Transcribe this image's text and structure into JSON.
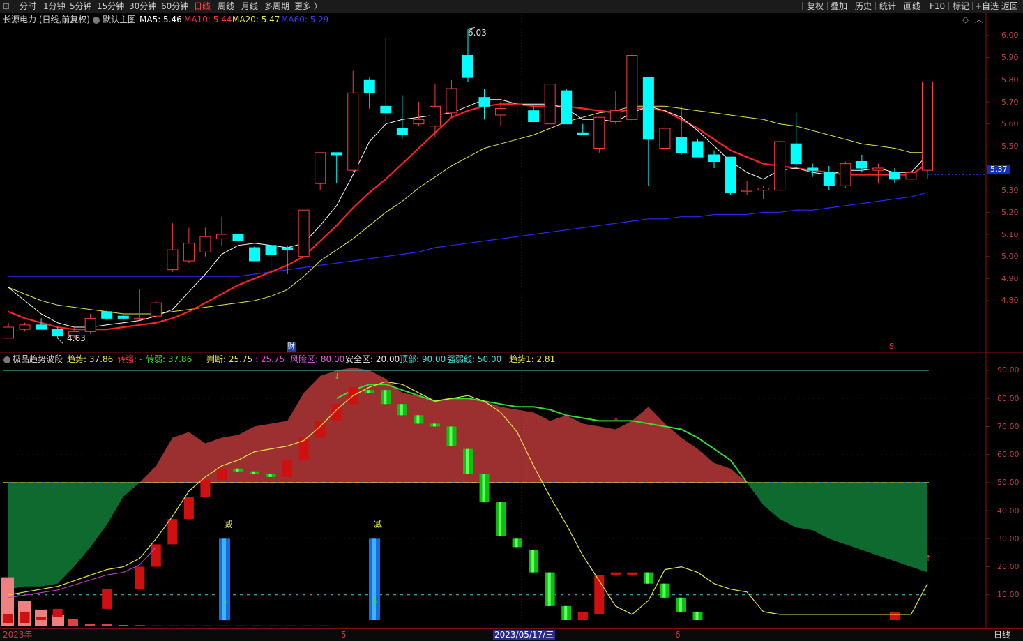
{
  "toolbar": {
    "left_tabs": [
      "分时",
      "1分钟",
      "5分钟",
      "15分钟",
      "30分钟",
      "60分钟",
      "日线",
      "周线",
      "月线",
      "多周期",
      "更多 〉"
    ],
    "active_tab": "日线",
    "right_items": [
      "复权",
      "叠加",
      "历史",
      "统计",
      "画线",
      "F10",
      "标记",
      "+自选",
      "返回"
    ]
  },
  "main_chart": {
    "title": "长源电力 (日线,前复权)",
    "template": "默认主图",
    "ma5": "MA5: 5.46",
    "ma10": "MA10: 5.44",
    "ma20": "MA20: 5.47",
    "ma60": "MA60: 5.29",
    "high_label": "6.03",
    "low_label": "4.63",
    "price_tag": "5.37",
    "finance_mark": "财",
    "s_mark": "S",
    "y_ticks": [
      "6.00",
      "5.90",
      "5.80",
      "5.70",
      "5.60",
      "5.50",
      "5.40",
      "5.30",
      "5.20",
      "5.10",
      "5.00",
      "4.90",
      "4.80"
    ]
  },
  "indicator": {
    "name": "极品趋势波段",
    "trend": "趋势: 37.86",
    "strong": "转强: -",
    "weak": "转弱: 37.86",
    "judge": "判断: 25.75",
    "judge2": ": 25.75",
    "risk": "风险区: 80.00",
    "safe": "安全区: 20.00",
    "top": "顶部: 90.00",
    "strength_line": "强弱线: 50.00",
    "trend1": "趋势1: 2.81",
    "reduce_label_1": "减",
    "reduce_label_2": "减",
    "y_ticks": [
      "90.00",
      "80.00",
      "70.00",
      "60.00",
      "50.00",
      "40.00",
      "30.00",
      "20.00",
      "10.00"
    ]
  },
  "x_axis": {
    "labels": [
      "2023年",
      "5",
      "2023/05/17/三",
      "6"
    ],
    "period": "日线"
  },
  "colors": {
    "up": "#ff3b3b",
    "down": "#00ffff",
    "ma5": "#ffffff",
    "ma10": "#ff2020",
    "ma20": "#e8e840",
    "ma60": "#2a2aff",
    "risk_fill": "#9c2f2f",
    "safe_fill": "#0e6a2e"
  },
  "chart_data": {
    "type": "candlestick",
    "ylim": [
      4.6,
      6.07
    ],
    "candles": [
      {
        "o": 4.63,
        "h": 4.7,
        "l": 4.63,
        "c": 4.68
      },
      {
        "o": 4.67,
        "h": 4.7,
        "l": 4.66,
        "c": 4.69
      },
      {
        "o": 4.69,
        "h": 4.72,
        "l": 4.67,
        "c": 4.67
      },
      {
        "o": 4.67,
        "h": 4.68,
        "l": 4.63,
        "c": 4.64
      },
      {
        "o": 4.64,
        "h": 4.68,
        "l": 4.63,
        "c": 4.66
      },
      {
        "o": 4.66,
        "h": 4.74,
        "l": 4.65,
        "c": 4.72
      },
      {
        "o": 4.75,
        "h": 4.76,
        "l": 4.71,
        "c": 4.72
      },
      {
        "o": 4.73,
        "h": 4.74,
        "l": 4.71,
        "c": 4.72
      },
      {
        "o": 4.72,
        "h": 4.85,
        "l": 4.71,
        "c": 4.72
      },
      {
        "o": 4.73,
        "h": 4.8,
        "l": 4.72,
        "c": 4.79
      },
      {
        "o": 4.94,
        "h": 5.15,
        "l": 4.93,
        "c": 5.03
      },
      {
        "o": 4.98,
        "h": 5.13,
        "l": 4.97,
        "c": 5.06
      },
      {
        "o": 5.02,
        "h": 5.13,
        "l": 5.0,
        "c": 5.09
      },
      {
        "o": 5.08,
        "h": 5.18,
        "l": 5.05,
        "c": 5.1
      },
      {
        "o": 5.1,
        "h": 5.11,
        "l": 5.05,
        "c": 5.07
      },
      {
        "o": 5.04,
        "h": 5.05,
        "l": 4.98,
        "c": 4.98
      },
      {
        "o": 5.05,
        "h": 5.06,
        "l": 4.92,
        "c": 5.01
      },
      {
        "o": 5.04,
        "h": 5.05,
        "l": 4.92,
        "c": 5.03
      },
      {
        "o": 5.0,
        "h": 5.21,
        "l": 5.0,
        "c": 5.21
      },
      {
        "o": 5.33,
        "h": 5.47,
        "l": 5.3,
        "c": 5.47
      },
      {
        "o": 5.47,
        "h": 5.47,
        "l": 5.33,
        "c": 5.46
      },
      {
        "o": 5.39,
        "h": 5.84,
        "l": 5.38,
        "c": 5.74
      },
      {
        "o": 5.8,
        "h": 5.81,
        "l": 5.67,
        "c": 5.74
      },
      {
        "o": 5.68,
        "h": 5.99,
        "l": 5.61,
        "c": 5.65
      },
      {
        "o": 5.58,
        "h": 5.73,
        "l": 5.53,
        "c": 5.55
      },
      {
        "o": 5.6,
        "h": 5.7,
        "l": 5.59,
        "c": 5.62
      },
      {
        "o": 5.59,
        "h": 5.78,
        "l": 5.54,
        "c": 5.68
      },
      {
        "o": 5.65,
        "h": 5.8,
        "l": 5.63,
        "c": 5.76
      },
      {
        "o": 5.91,
        "h": 6.03,
        "l": 5.79,
        "c": 5.81
      },
      {
        "o": 5.72,
        "h": 5.76,
        "l": 5.62,
        "c": 5.68
      },
      {
        "o": 5.64,
        "h": 5.7,
        "l": 5.59,
        "c": 5.67
      },
      {
        "o": 5.69,
        "h": 5.73,
        "l": 5.64,
        "c": 5.69
      },
      {
        "o": 5.66,
        "h": 5.68,
        "l": 5.61,
        "c": 5.61
      },
      {
        "o": 5.6,
        "h": 5.78,
        "l": 5.6,
        "c": 5.78
      },
      {
        "o": 5.75,
        "h": 5.76,
        "l": 5.6,
        "c": 5.6
      },
      {
        "o": 5.56,
        "h": 5.6,
        "l": 5.55,
        "c": 5.55
      },
      {
        "o": 5.49,
        "h": 5.63,
        "l": 5.47,
        "c": 5.63
      },
      {
        "o": 5.61,
        "h": 5.75,
        "l": 5.6,
        "c": 5.66
      },
      {
        "o": 5.62,
        "h": 5.91,
        "l": 5.61,
        "c": 5.91
      },
      {
        "o": 5.81,
        "h": 5.81,
        "l": 5.32,
        "c": 5.53
      },
      {
        "o": 5.49,
        "h": 5.68,
        "l": 5.44,
        "c": 5.58
      },
      {
        "o": 5.54,
        "h": 5.68,
        "l": 5.46,
        "c": 5.47
      },
      {
        "o": 5.52,
        "h": 5.53,
        "l": 5.45,
        "c": 5.45
      },
      {
        "o": 5.46,
        "h": 5.48,
        "l": 5.4,
        "c": 5.43
      },
      {
        "o": 5.45,
        "h": 5.45,
        "l": 5.28,
        "c": 5.29
      },
      {
        "o": 5.3,
        "h": 5.34,
        "l": 5.28,
        "c": 5.3
      },
      {
        "o": 5.3,
        "h": 5.32,
        "l": 5.26,
        "c": 5.31
      },
      {
        "o": 5.3,
        "h": 5.52,
        "l": 5.3,
        "c": 5.52
      },
      {
        "o": 5.51,
        "h": 5.65,
        "l": 5.4,
        "c": 5.42
      },
      {
        "o": 5.4,
        "h": 5.42,
        "l": 5.36,
        "c": 5.39
      },
      {
        "o": 5.38,
        "h": 5.41,
        "l": 5.3,
        "c": 5.32
      },
      {
        "o": 5.32,
        "h": 5.43,
        "l": 5.31,
        "c": 5.42
      },
      {
        "o": 5.43,
        "h": 5.46,
        "l": 5.38,
        "c": 5.4
      },
      {
        "o": 5.39,
        "h": 5.42,
        "l": 5.33,
        "c": 5.4
      },
      {
        "o": 5.38,
        "h": 5.4,
        "l": 5.33,
        "c": 5.35
      },
      {
        "o": 5.35,
        "h": 5.4,
        "l": 5.3,
        "c": 5.38
      },
      {
        "o": 5.39,
        "h": 5.79,
        "l": 5.35,
        "c": 5.79
      }
    ],
    "ma5": [
      4.86,
      4.8,
      4.74,
      4.7,
      4.68,
      4.68,
      4.69,
      4.7,
      4.71,
      4.73,
      4.76,
      4.84,
      4.92,
      5.01,
      5.05,
      5.06,
      5.05,
      5.04,
      5.06,
      5.14,
      5.23,
      5.37,
      5.52,
      5.6,
      5.62,
      5.63,
      5.64,
      5.65,
      5.68,
      5.71,
      5.71,
      5.69,
      5.69,
      5.69,
      5.67,
      5.62,
      5.62,
      5.61,
      5.65,
      5.68,
      5.66,
      5.63,
      5.57,
      5.5,
      5.43,
      5.38,
      5.35,
      5.39,
      5.4,
      5.38,
      5.37,
      5.39,
      5.39,
      5.4,
      5.38,
      5.38,
      5.46
    ],
    "ma10": [
      4.75,
      4.72,
      4.7,
      4.68,
      4.67,
      4.67,
      4.67,
      4.68,
      4.69,
      4.7,
      4.72,
      4.75,
      4.79,
      4.83,
      4.87,
      4.9,
      4.93,
      4.96,
      5.0,
      5.07,
      5.14,
      5.22,
      5.29,
      5.35,
      5.42,
      5.49,
      5.56,
      5.63,
      5.66,
      5.68,
      5.69,
      5.69,
      5.68,
      5.68,
      5.68,
      5.67,
      5.66,
      5.65,
      5.67,
      5.67,
      5.66,
      5.62,
      5.58,
      5.53,
      5.48,
      5.45,
      5.42,
      5.41,
      5.4,
      5.39,
      5.38,
      5.37,
      5.37,
      5.37,
      5.37,
      5.37,
      5.42
    ],
    "ma20": [
      4.86,
      4.83,
      4.8,
      4.78,
      4.77,
      4.76,
      4.75,
      4.74,
      4.74,
      4.74,
      4.75,
      4.76,
      4.77,
      4.78,
      4.79,
      4.8,
      4.82,
      4.85,
      4.91,
      4.98,
      5.03,
      5.08,
      5.14,
      5.2,
      5.25,
      5.31,
      5.36,
      5.41,
      5.45,
      5.49,
      5.51,
      5.53,
      5.55,
      5.58,
      5.61,
      5.63,
      5.65,
      5.66,
      5.68,
      5.68,
      5.68,
      5.67,
      5.66,
      5.65,
      5.64,
      5.63,
      5.62,
      5.6,
      5.59,
      5.57,
      5.55,
      5.53,
      5.51,
      5.5,
      5.49,
      5.47,
      5.47
    ],
    "ma60": [
      4.91,
      4.91,
      4.91,
      4.91,
      4.91,
      4.91,
      4.91,
      4.91,
      4.91,
      4.91,
      4.91,
      4.91,
      4.91,
      4.91,
      4.91,
      4.92,
      4.93,
      4.94,
      4.95,
      4.96,
      4.97,
      4.98,
      4.99,
      5.0,
      5.01,
      5.02,
      5.04,
      5.05,
      5.06,
      5.07,
      5.08,
      5.09,
      5.1,
      5.11,
      5.12,
      5.13,
      5.14,
      5.15,
      5.16,
      5.17,
      5.17,
      5.18,
      5.18,
      5.19,
      5.19,
      5.19,
      5.2,
      5.2,
      5.21,
      5.21,
      5.22,
      5.23,
      5.24,
      5.25,
      5.26,
      5.27,
      5.29
    ],
    "indicator": {
      "ylim": [
        0,
        94
      ],
      "risk": 80,
      "safe": 20,
      "top": 90,
      "strength": 50,
      "upper_band": [
        12,
        13,
        13,
        14,
        20,
        27,
        35,
        45,
        50,
        56,
        66,
        68,
        64,
        66,
        67,
        70,
        71,
        72,
        82,
        88,
        90,
        91,
        90,
        87,
        82,
        81,
        79,
        80,
        80,
        79,
        77,
        76,
        75,
        72,
        74,
        71,
        70,
        69,
        72,
        77,
        71,
        66,
        62,
        57,
        55,
        50,
        42,
        37,
        34,
        33,
        30,
        28,
        26,
        24,
        22,
        20,
        18
      ],
      "green_line": [
        50,
        50,
        50,
        50,
        50,
        50,
        50,
        50,
        50,
        50,
        50,
        50,
        50,
        50,
        50,
        50,
        50,
        50,
        50,
        50,
        80,
        83,
        85,
        85,
        83,
        81,
        79,
        80,
        80,
        79,
        78,
        77,
        77,
        76,
        74,
        73,
        72,
        72,
        72,
        71,
        70,
        69,
        66,
        62,
        58,
        50,
        50,
        50,
        50,
        50,
        50,
        50,
        50,
        50,
        50,
        50,
        50
      ],
      "yellow_line": [
        10,
        11,
        12,
        13,
        15,
        17,
        19,
        20,
        23,
        30,
        38,
        47,
        52,
        56,
        58,
        61,
        62,
        63,
        65,
        70,
        76,
        81,
        84,
        86,
        85,
        82,
        79,
        80,
        81,
        79,
        75,
        68,
        56,
        45,
        35,
        24,
        15,
        6,
        3,
        8,
        19,
        20,
        18,
        14,
        12,
        11,
        4,
        3,
        3,
        3,
        3,
        3,
        3,
        3,
        3,
        3,
        14
      ],
      "bars": [
        {
          "from": 0,
          "to": 3,
          "c": "up"
        },
        {
          "from": 0,
          "to": 4,
          "c": "up"
        },
        {
          "from": 1,
          "to": 2,
          "c": "up"
        },
        {
          "from": 2,
          "to": 5,
          "c": "up"
        },
        {
          "from": 5,
          "to": 12,
          "c": "up"
        },
        {
          "from": 12,
          "to": 20,
          "c": "up"
        },
        {
          "from": 20,
          "to": 28,
          "c": "up"
        },
        {
          "from": 28,
          "to": 37,
          "c": "up"
        },
        {
          "from": 37,
          "to": 45,
          "c": "up"
        },
        {
          "from": 45,
          "to": 51,
          "c": "up"
        },
        {
          "from": 51,
          "to": 55,
          "c": "up"
        },
        {
          "from": 54,
          "to": 55,
          "c": "down"
        },
        {
          "from": 53,
          "to": 54,
          "c": "down"
        },
        {
          "from": 52,
          "to": 53,
          "c": "down"
        },
        {
          "from": 52,
          "to": 58,
          "c": "up"
        },
        {
          "from": 58,
          "to": 66,
          "c": "up"
        },
        {
          "from": 66,
          "to": 72,
          "c": "up"
        },
        {
          "from": 72,
          "to": 78,
          "c": "up"
        },
        {
          "from": 78,
          "to": 84,
          "c": "up"
        },
        {
          "from": 82,
          "to": 83,
          "c": "down"
        },
        {
          "from": 78,
          "to": 83,
          "c": "down"
        },
        {
          "from": 74,
          "to": 78,
          "c": "down"
        },
        {
          "from": 71,
          "to": 74,
          "c": "down"
        },
        {
          "from": 70,
          "to": 71,
          "c": "down"
        },
        {
          "from": 63,
          "to": 70,
          "c": "down"
        },
        {
          "from": 53,
          "to": 62,
          "c": "down"
        },
        {
          "from": 43,
          "to": 53,
          "c": "down"
        },
        {
          "from": 31,
          "to": 43,
          "c": "down"
        },
        {
          "from": 27,
          "to": 30,
          "c": "down"
        },
        {
          "from": 18,
          "to": 26,
          "c": "down"
        },
        {
          "from": 6,
          "to": 18,
          "c": "down"
        },
        {
          "from": 1,
          "to": 6,
          "c": "down"
        },
        {
          "from": 1,
          "to": 4,
          "c": "up"
        },
        {
          "from": 3,
          "to": 17,
          "c": "up"
        },
        {
          "from": 17,
          "to": 18,
          "c": "up"
        },
        {
          "from": 17,
          "to": 18,
          "c": "up"
        },
        {
          "from": 14,
          "to": 18,
          "c": "down"
        },
        {
          "from": 9,
          "to": 14,
          "c": "down"
        },
        {
          "from": 4,
          "to": 9,
          "c": "down"
        },
        {
          "from": 1,
          "to": 4,
          "c": "down"
        },
        {
          "from": 1,
          "to": 4,
          "c": "up"
        }
      ],
      "bar_positions": [
        0,
        1,
        2,
        3,
        6,
        8,
        9,
        10,
        11,
        12,
        13,
        14,
        15,
        16,
        17,
        18,
        19,
        20,
        21,
        22,
        23,
        24,
        25,
        26,
        27,
        28,
        29,
        30,
        31,
        32,
        33,
        34,
        35,
        36,
        37,
        38,
        39,
        40,
        41,
        42,
        54
      ],
      "volume_bars": [
        17.5,
        9,
        6,
        4,
        2.5,
        1,
        0.8,
        0.5,
        0.4,
        0.3,
        0.3,
        0.3,
        0.3,
        0.3,
        0.3,
        0.3,
        0.3,
        0.3,
        0.3,
        0.3
      ]
    }
  }
}
